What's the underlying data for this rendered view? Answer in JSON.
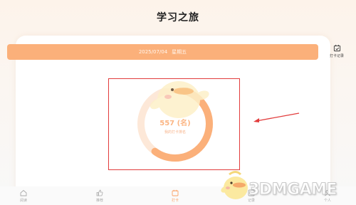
{
  "header": {
    "title": "学习之旅"
  },
  "date_bar": {
    "date": "2025/07/04",
    "weekday": "星期五"
  },
  "checkin_record": {
    "label": "打卡记录",
    "icon": "calendar-check-icon"
  },
  "ranking": {
    "value_text": "557 (名)",
    "label": "我的打卡排名",
    "progress_fraction": 0.6
  },
  "tabs": [
    {
      "label": "阅读",
      "icon": "home-icon"
    },
    {
      "label": "推荐",
      "icon": "thumbs-up-icon"
    },
    {
      "label": "打卡",
      "icon": "calendar-icon",
      "active": true
    },
    {
      "label": "记录",
      "icon": "chart-icon"
    },
    {
      "label": "个人",
      "icon": "user-icon"
    }
  ],
  "watermark": {
    "text": "3DMGAME"
  },
  "colors": {
    "accent": "#fbb07a",
    "ring_track": "#fde8d8",
    "annotation": "#e23c3c"
  }
}
